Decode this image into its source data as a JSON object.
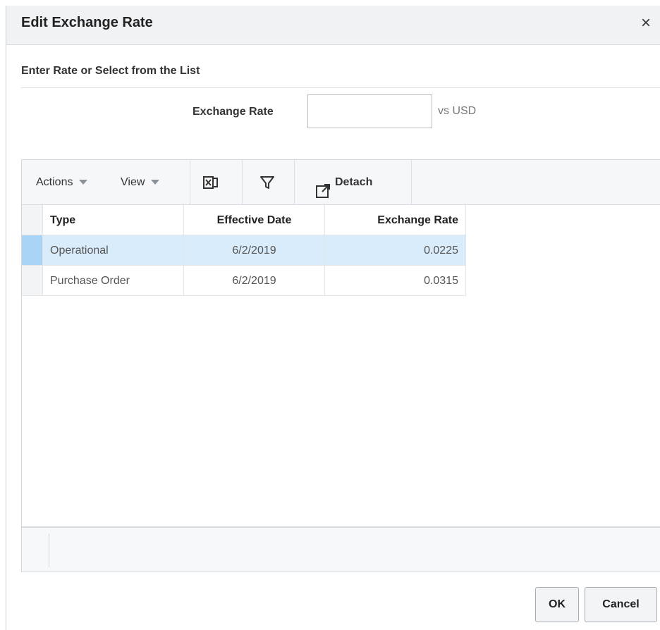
{
  "dialog": {
    "title": "Edit Exchange Rate",
    "close_glyph": "×"
  },
  "section": {
    "header": "Enter Rate or Select from the List"
  },
  "rate_field": {
    "label": "Exchange Rate",
    "value": "",
    "unit": "vs USD"
  },
  "toolbar": {
    "actions_label": "Actions",
    "view_label": "View",
    "export_icon": "export-to-excel-icon",
    "filter_icon": "filter-icon",
    "detach_label": "Detach",
    "detach_icon": "detach-icon"
  },
  "table": {
    "columns": [
      "Type",
      "Effective Date",
      "Exchange Rate"
    ],
    "rows": [
      {
        "type": "Operational",
        "effective_date": "6/2/2019",
        "exchange_rate": "0.0225",
        "selected": true
      },
      {
        "type": "Purchase Order",
        "effective_date": "6/2/2019",
        "exchange_rate": "0.0315",
        "selected": false
      }
    ]
  },
  "buttons": {
    "ok_label": "OK",
    "cancel_label": "Cancel"
  },
  "colors": {
    "selected_row": "#d9ecfb",
    "selected_row_marker": "#a9d4f5",
    "header_background": "#f0f2f4"
  }
}
